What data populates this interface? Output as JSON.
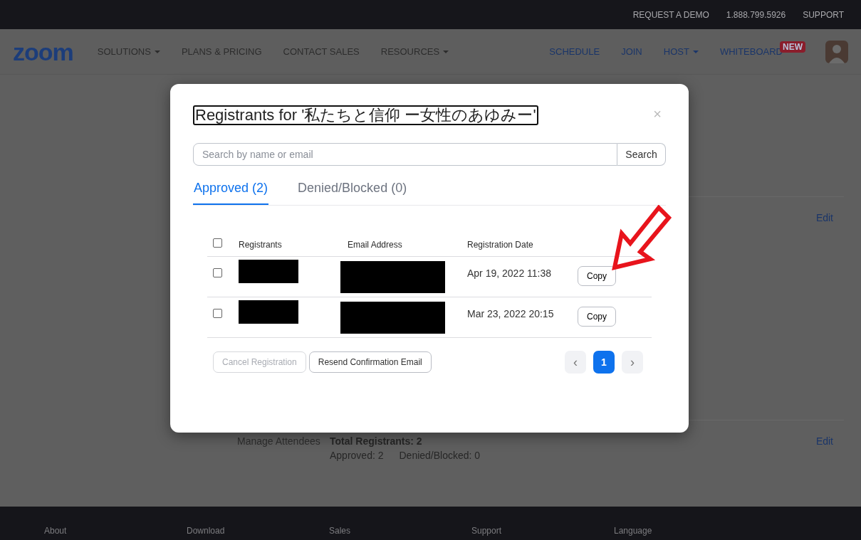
{
  "top_bar": {
    "links": [
      "REQUEST A DEMO",
      "1.888.799.5926",
      "SUPPORT"
    ]
  },
  "nav": {
    "logo": "zoom",
    "left": [
      {
        "label": "SOLUTIONS",
        "dropdown": true
      },
      {
        "label": "PLANS & PRICING",
        "dropdown": false
      },
      {
        "label": "CONTACT SALES",
        "dropdown": false
      },
      {
        "label": "RESOURCES",
        "dropdown": true
      }
    ],
    "right": [
      {
        "label": "SCHEDULE",
        "dropdown": false
      },
      {
        "label": "JOIN",
        "dropdown": false
      },
      {
        "label": "HOST",
        "dropdown": true
      },
      {
        "label": "WHITEBOARD",
        "dropdown": false,
        "badge": "NEW"
      }
    ]
  },
  "page": {
    "edit_links": [
      "Edit",
      "Edit"
    ],
    "manage_label": "Manage Attendees",
    "total": "Total Registrants: 2",
    "approved": "Approved: 2",
    "denied": "Denied/Blocked: 0"
  },
  "modal": {
    "title": "Registrants for '私たちと信仰 ー女性のあゆみー'",
    "close": "×",
    "search": {
      "placeholder": "Search by name or email",
      "button": "Search"
    },
    "tabs": [
      {
        "label": "Approved (2)",
        "selected": true
      },
      {
        "label": "Denied/Blocked (0)",
        "selected": false
      }
    ],
    "table": {
      "select_all_checked": false,
      "columns": [
        "Registrants",
        "Email Address",
        "Registration Date"
      ],
      "rows": [
        {
          "checked": false,
          "redacted": true,
          "date": "Apr 19, 2022 11:38",
          "action": "Copy"
        },
        {
          "checked": false,
          "redacted": true,
          "date": "Mar 23, 2022 20:15",
          "action": "Copy"
        }
      ]
    },
    "buttons": [
      {
        "label": "Cancel Registration",
        "disabled": true
      },
      {
        "label": "Resend Confirmation Email",
        "disabled": false
      }
    ],
    "pagination": {
      "prev": "‹",
      "pages": [
        {
          "label": "1",
          "selected": true
        }
      ],
      "next": "›"
    },
    "annotations": [
      {
        "kind": "arrow"
      }
    ]
  },
  "footer": {
    "columns": [
      "About",
      "Download",
      "Sales",
      "Support",
      "Language"
    ]
  }
}
